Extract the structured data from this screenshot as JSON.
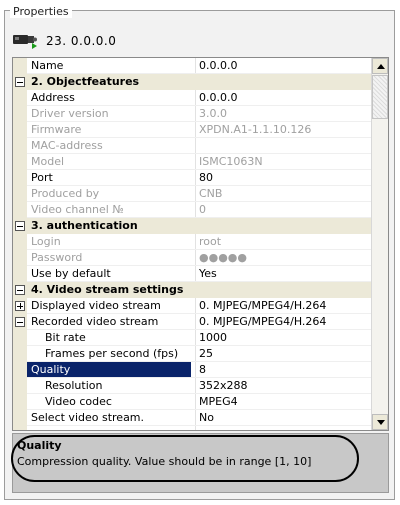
{
  "panel_title": "Properties",
  "device": {
    "label": "23. 0.0.0.0",
    "icon": "camera-icon"
  },
  "rows": [
    {
      "label": "Name",
      "value": "0.0.0.0"
    },
    {
      "label": "2. Objectfeatures"
    },
    {
      "label": "Address",
      "value": "0.0.0.0"
    },
    {
      "label": "Driver version",
      "value": "3.0.0"
    },
    {
      "label": "Firmware",
      "value": "XPDN.A1-1.1.10.126"
    },
    {
      "label": "MAC-address",
      "value": ""
    },
    {
      "label": "Model",
      "value": "ISMC1063N"
    },
    {
      "label": "Port",
      "value": "80"
    },
    {
      "label": "Produced by",
      "value": "CNB"
    },
    {
      "label": "Video channel №",
      "value": "0"
    },
    {
      "label": "3. authentication"
    },
    {
      "label": "Login",
      "value": "root"
    },
    {
      "label": "Password",
      "value": "●●●●●"
    },
    {
      "label": "Use by default",
      "value": "Yes"
    },
    {
      "label": "4. Video stream settings"
    },
    {
      "label": "Displayed video stream",
      "value": "0. MJPEG/MPEG4/H.264"
    },
    {
      "label": "Recorded video stream",
      "value": "0. MJPEG/MPEG4/H.264"
    },
    {
      "label": "Bit rate",
      "value": "1000"
    },
    {
      "label": "Frames per second (fps)",
      "value": "25"
    },
    {
      "label": "Quality",
      "value": "8"
    },
    {
      "label": "Resolution",
      "value": "352x288"
    },
    {
      "label": "Video codec",
      "value": "MPEG4"
    },
    {
      "label": "Select video stream.",
      "value": "No"
    }
  ],
  "help": {
    "title": "Quality",
    "description": "Compression quality. Value should be in range [1, 10]"
  },
  "colors": {
    "selection": "#0a246a",
    "section_bg": "#ece9d8",
    "disabled_text": "#a0a0a0"
  }
}
